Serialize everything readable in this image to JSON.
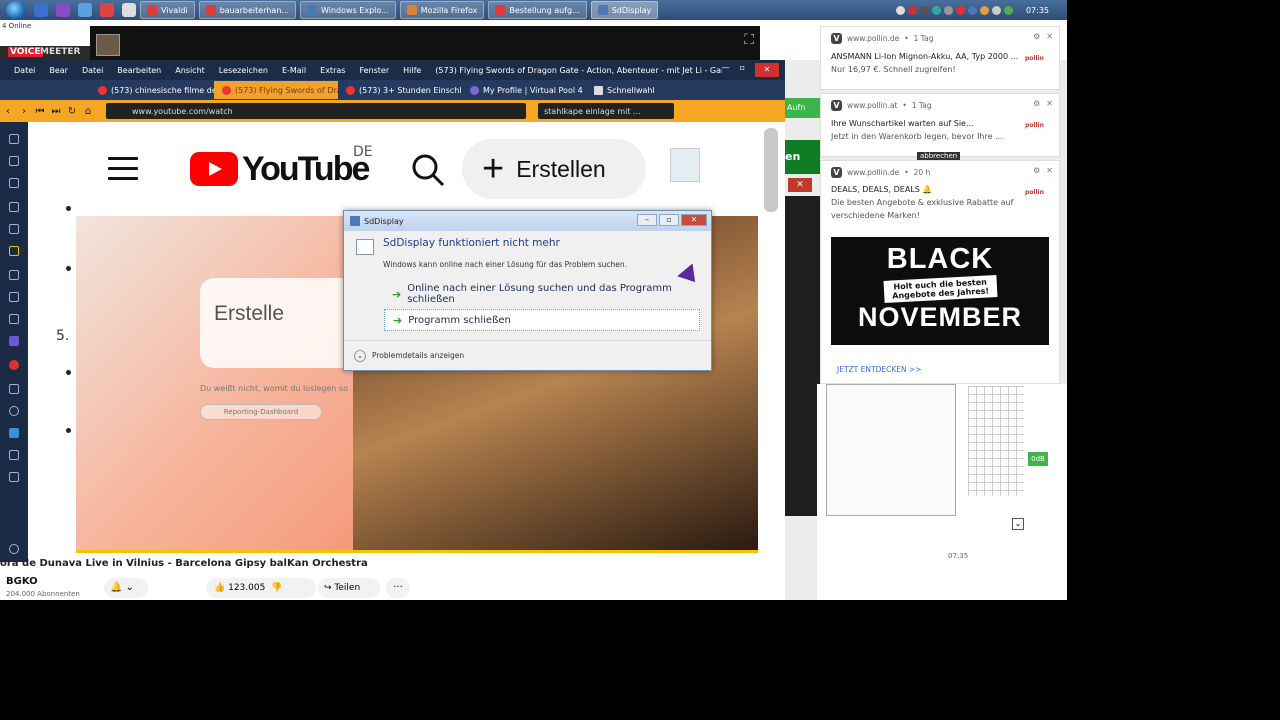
{
  "taskbar": {
    "online_label": "4 Online",
    "tasks": [
      {
        "label": "Vivaldi",
        "color": "#e03b3b"
      },
      {
        "label": "bauarbeiterhan...",
        "color": "#e03b3b"
      },
      {
        "label": "Windows Explo...",
        "color": "#4a79b6"
      },
      {
        "label": "Mozilla Firefox",
        "color": "#e0803b"
      },
      {
        "label": "Bestellung aufg...",
        "color": "#e03b3b"
      },
      {
        "label": "SdDisplay",
        "color": "#4a79b6"
      }
    ],
    "clock": "07:35"
  },
  "voicemeeter": {
    "voice": "VOICE",
    "meeter": "MEETER"
  },
  "browser": {
    "menu": [
      "Datei",
      "Bear",
      "Datei",
      "Bearbeiten",
      "Ansicht",
      "Lesezeichen",
      "E-Mail",
      "Extras",
      "Fenster",
      "Hilfe"
    ],
    "window_title": "(573) Flying Swords of Dragon Gate - Action, Abenteuer - mit Jet Li - Ganzen Fil...",
    "tabs": [
      {
        "label": "(573) chinesische filme deut",
        "active": false
      },
      {
        "label": "(573) Flying Swords of Drago",
        "active": true
      },
      {
        "label": "(573) 3+ Stunden Einschlaf",
        "active": false
      },
      {
        "label": "My Profile | Virtual Pool 4",
        "active": false
      },
      {
        "label": "Schnellwahl",
        "active": false
      }
    ],
    "url": "www.youtube.com/watch",
    "search_text": "stahlkape einlage mit ..."
  },
  "youtube": {
    "logo_text": "YouTube",
    "region": "DE",
    "create_label": "Erstellen",
    "video_card_text": "Erstelle",
    "video_sub_text": "Du weißt nicht, womit du loslegen so",
    "video_pill": "Reporting-Dashboard",
    "list_number": "5.",
    "under_title": "ora de Dunava Live in Vilnius - Barcelona Gipsy balKan Orchestra",
    "channel": "BGKO",
    "subscribers": "204.000 Abonnenten",
    "likes": "123.005",
    "share_label": "Teilen"
  },
  "dialog": {
    "title": "SdDisplay",
    "heading": "SdDisplay funktioniert nicht mehr",
    "message": "Windows kann online nach einer Lösung für das Problem suchen.",
    "option1": "Online nach einer Lösung suchen und das Programm schließen",
    "option2": "Programm schließen",
    "details": "Problemdetails anzeigen"
  },
  "right_panel": {
    "green_label": "Aufn",
    "green_label2": "en",
    "time": "07:35",
    "db_label": "0dB"
  },
  "notifications": [
    {
      "source": "www.pollin.de",
      "age": "1 Tag",
      "line1": "ANSMANN Li-Ion Mignon-Akku, AA, Typ 2000 ...",
      "line2": "Nur 16,97 €. Schnell zugreifen!"
    },
    {
      "source": "www.pollin.at",
      "age": "1 Tag",
      "line1": "Ihre Wunschartikel warten auf Sie...",
      "line2": "Jetzt in den Warenkorb legen, bevor Ihre ..."
    },
    {
      "source": "www.pollin.de",
      "age": "20 h",
      "line1": "DEALS, DEALS, DEALS 🔔",
      "line2": "Die besten Angebote & exklusive Rabatte auf",
      "line3": "verschiedene Marken!",
      "promo_big1": "BLACK",
      "promo_mid1": "Holt euch die besten",
      "promo_mid2": "Angebote des Jahres!",
      "promo_big2": "NOVEMBER",
      "cta": "JETZT ENTDECKEN >>"
    }
  ],
  "notif_overlay": "abbrechen",
  "pollin_logo": "pollin"
}
